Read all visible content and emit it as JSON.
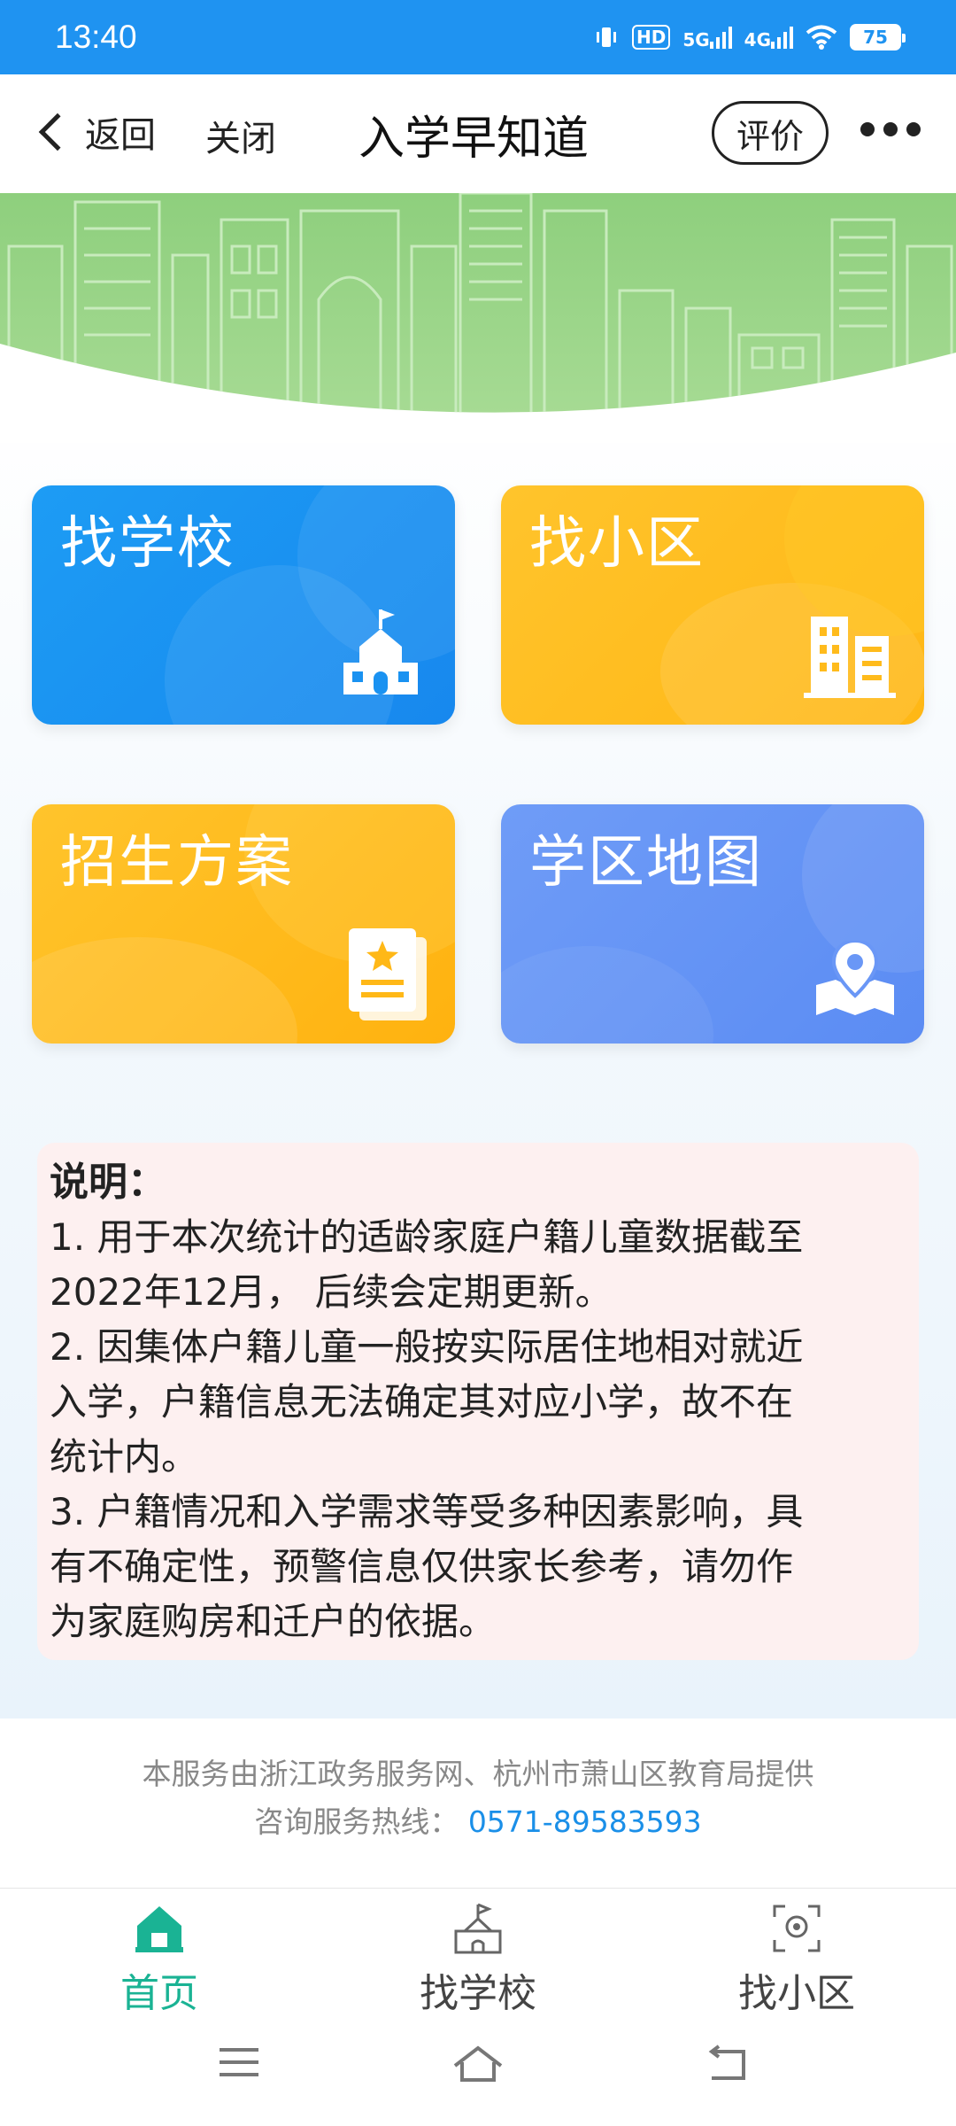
{
  "status_bar": {
    "time": "13:40",
    "hd_label": "HD",
    "net1_label": "5G",
    "net2_label": "4G",
    "battery": "75",
    "icons": [
      "vibrate-icon",
      "hd-call-icon",
      "signal-5g-icon",
      "signal-4g-icon",
      "wifi-icon",
      "battery-icon"
    ]
  },
  "nav": {
    "back_label": "返回",
    "close_label": "关闭",
    "title": "入学早知道",
    "rate_label": "评价"
  },
  "cards": [
    {
      "label": "找学校",
      "icon": "school-building-icon",
      "color": "#1d9cf4"
    },
    {
      "label": "找小区",
      "icon": "apartment-building-icon",
      "color": "#ffbd22"
    },
    {
      "label": "招生方案",
      "icon": "document-star-icon",
      "color": "#ffba1a"
    },
    {
      "label": "学区地图",
      "icon": "map-pin-icon",
      "color": "#6a97f6"
    }
  ],
  "notes": {
    "title": "说明：",
    "items": [
      "1. 用于本次统计的适龄家庭户籍儿童数据截至",
      "2022年12月， 后续会定期更新。",
      "2. 因集体户籍儿童一般按实际居住地相对就近",
      "入学，户籍信息无法确定其对应小学，故不在",
      "统计内。",
      "3. 户籍情况和入学需求等受多种因素影响，具",
      "有不确定性，预警信息仅供家长参考，请勿作",
      "为家庭购房和迁户的依据。"
    ]
  },
  "footer": {
    "provider": "本服务由浙江政务服务网、杭州市萧山区教育局提供",
    "hotline_label": "咨询服务热线：",
    "hotline_number": "0571-89583593"
  },
  "tabs": [
    {
      "label": "首页",
      "icon": "home-icon",
      "active": true
    },
    {
      "label": "找学校",
      "icon": "school-icon",
      "active": false
    },
    {
      "label": "找小区",
      "icon": "community-locate-icon",
      "active": false
    }
  ],
  "colors": {
    "status_bar": "#1f93f1",
    "active_tab": "#1ab394",
    "hotline": "#1a8fe8",
    "banner_green": "#8fcf7e",
    "notes_bg": "#fdf0f0"
  }
}
